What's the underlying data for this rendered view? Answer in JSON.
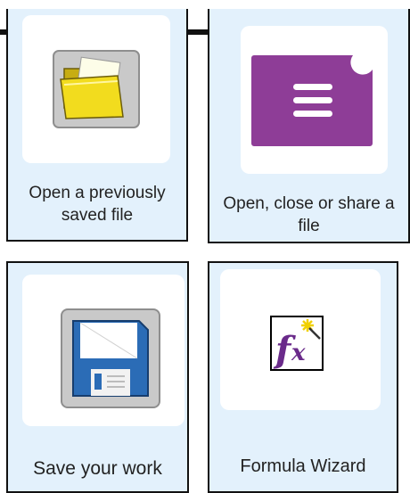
{
  "cards": [
    {
      "label": "Open a previously saved file",
      "icon": "open-folder-icon"
    },
    {
      "label": "Open, close or share a file",
      "icon": "hamburger-menu-icon"
    },
    {
      "label": "Save your work",
      "icon": "floppy-disk-icon"
    },
    {
      "label": "Formula Wizard",
      "icon": "formula-wizard-icon"
    }
  ],
  "colors": {
    "card_background": "#e3f1fc",
    "folder": "#f2dc1e",
    "menu_purple": "#8e3d97",
    "floppy_blue": "#2b6cb6",
    "fx_purple": "#6a2a8a"
  }
}
